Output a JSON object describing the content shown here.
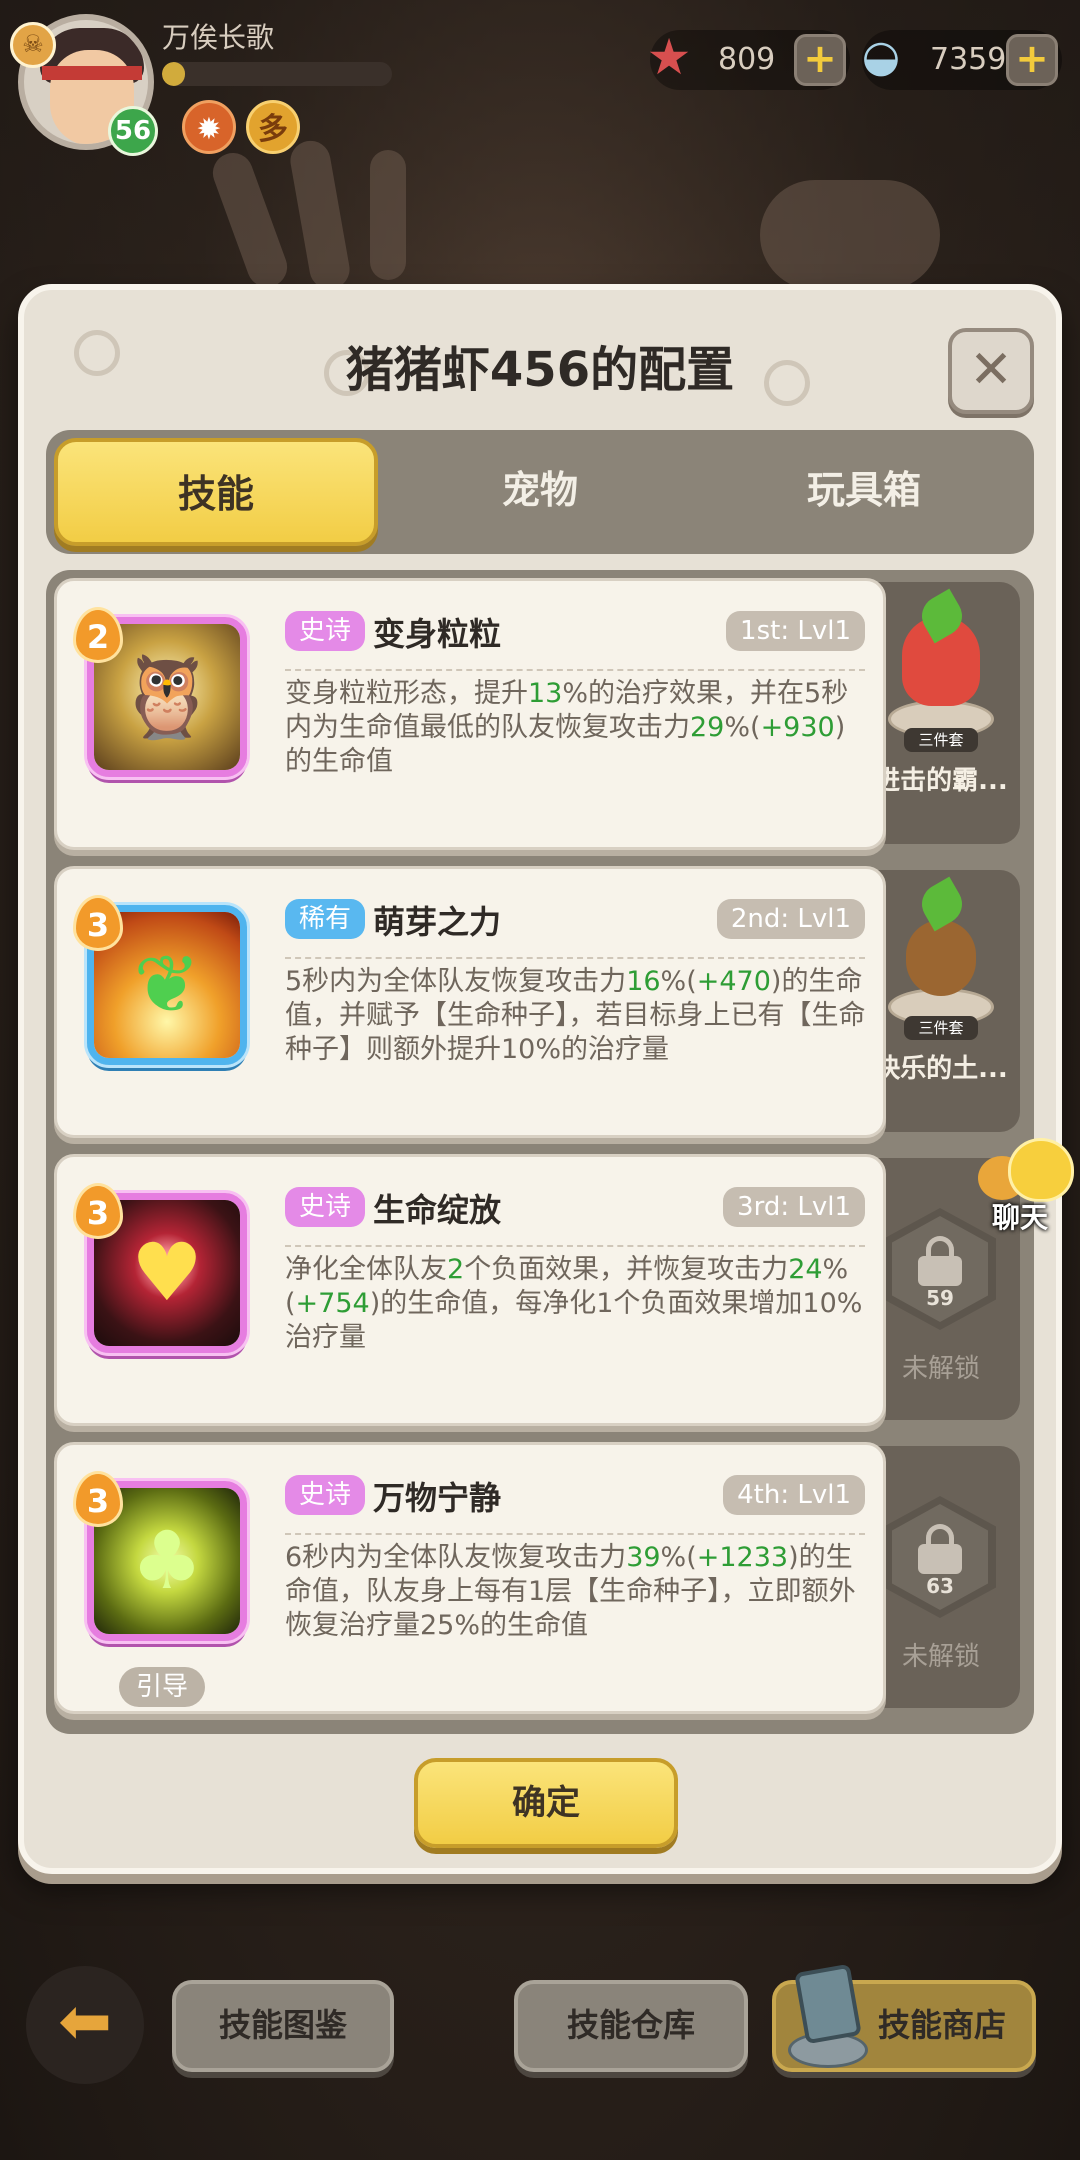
{
  "player": {
    "name": "万俟长歌",
    "level": "56",
    "xp_fraction": 0.1
  },
  "currencies": [
    {
      "icon": "starfish-icon",
      "value": "809"
    },
    {
      "icon": "shell-icon",
      "value": "7359"
    }
  ],
  "dialog": {
    "title": "猪猪虾456的配置",
    "tabs": [
      "技能",
      "宠物",
      "玩具箱"
    ],
    "active_tab": "技能",
    "confirm_label": "确定"
  },
  "skills": [
    {
      "level": "2",
      "rarity": "史诗",
      "rarity_type": "epic",
      "name": "变身粒粒",
      "slot": "1st: Lvl1",
      "desc": [
        {
          "t": "变身粒粒形态，提升"
        },
        {
          "t": "13",
          "g": true
        },
        {
          "t": "%的治疗效果，并在5秒内为生命值最低的队友恢复攻击力"
        },
        {
          "t": "29",
          "g": true
        },
        {
          "t": "%("
        },
        {
          "t": "+930",
          "g": true
        },
        {
          "t": ")的生命值"
        }
      ]
    },
    {
      "level": "3",
      "rarity": "稀有",
      "rarity_type": "rare",
      "name": "萌芽之力",
      "slot": "2nd: Lvl1",
      "desc": [
        {
          "t": "5秒内为全体队友恢复攻击力"
        },
        {
          "t": "16",
          "g": true
        },
        {
          "t": "%("
        },
        {
          "t": "+470",
          "g": true
        },
        {
          "t": ")的生命值，并赋予【生命种子】，若目标身上已有【生命种子】则额外提升10%的治疗量"
        }
      ]
    },
    {
      "level": "3",
      "rarity": "史诗",
      "rarity_type": "epic",
      "name": "生命绽放",
      "slot": "3rd: Lvl1",
      "desc": [
        {
          "t": "净化全体队友"
        },
        {
          "t": "2",
          "g": true
        },
        {
          "t": "个负面效果，并恢复攻击力"
        },
        {
          "t": "24",
          "g": true
        },
        {
          "t": "%("
        },
        {
          "t": "+754",
          "g": true
        },
        {
          "t": ")的生命值，每净化1个负面效果增加10%治疗量"
        }
      ]
    },
    {
      "level": "3",
      "rarity": "史诗",
      "rarity_type": "epic",
      "name": "万物宁静",
      "slot": "4th: Lvl1",
      "guide_label": "引导",
      "desc": [
        {
          "t": "6秒内为全体队友恢复攻击力"
        },
        {
          "t": "39",
          "g": true
        },
        {
          "t": "%("
        },
        {
          "t": "+1233",
          "g": true
        },
        {
          "t": ")的生命值，队友身上每有1层【生命种子】，立即额外恢复治疗量25%的生命值"
        }
      ]
    }
  ],
  "side_slots": [
    {
      "type": "pet",
      "name": "进击的霸...",
      "set_tag": "三件套"
    },
    {
      "type": "pet",
      "name": "快乐的土...",
      "set_tag": "三件套"
    },
    {
      "type": "locked",
      "unlock_level": "59",
      "label": "未解锁"
    },
    {
      "type": "locked",
      "unlock_level": "63",
      "label": "未解锁"
    }
  ],
  "chat": {
    "label": "聊天"
  },
  "bottom_bar": {
    "skill_guide": "技能图鉴",
    "skill_storage": "技能仓库",
    "skill_shop": "技能商店"
  },
  "colors": {
    "accent_yellow": "#f2cd45",
    "epic_pink": "#e48ae7",
    "rare_blue": "#59b8f0",
    "value_green": "#2e9d35"
  }
}
